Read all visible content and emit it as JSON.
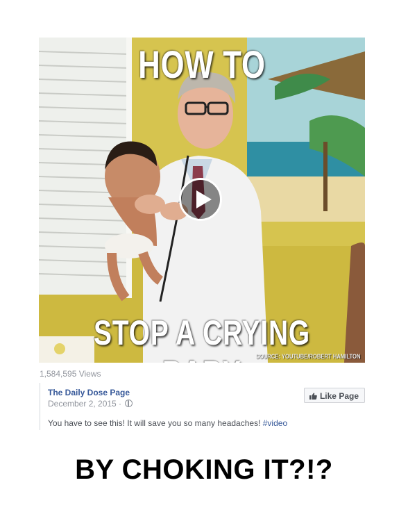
{
  "video": {
    "caption_top": "HOW TO",
    "caption_bottom": "STOP A CRYING BABY",
    "source_credit": "SOURCE: YOUTUBE/ROBERT HAMILTON",
    "play_icon": "play-icon"
  },
  "views": "1,584,595 Views",
  "post": {
    "page_name": "The Daily Dose Page",
    "date": "December 2, 2015 ·",
    "privacy_icon": "globe-icon",
    "like_button_label": "Like Page",
    "like_icon": "thumbs-up-icon",
    "text": "You have to see this! It will save you so many headaches! ",
    "hashtag": "#video"
  },
  "meme_caption": "BY CHOKING IT?!?",
  "colors": {
    "link": "#365899",
    "meta": "#90949c",
    "wall": "#d9c85a"
  }
}
